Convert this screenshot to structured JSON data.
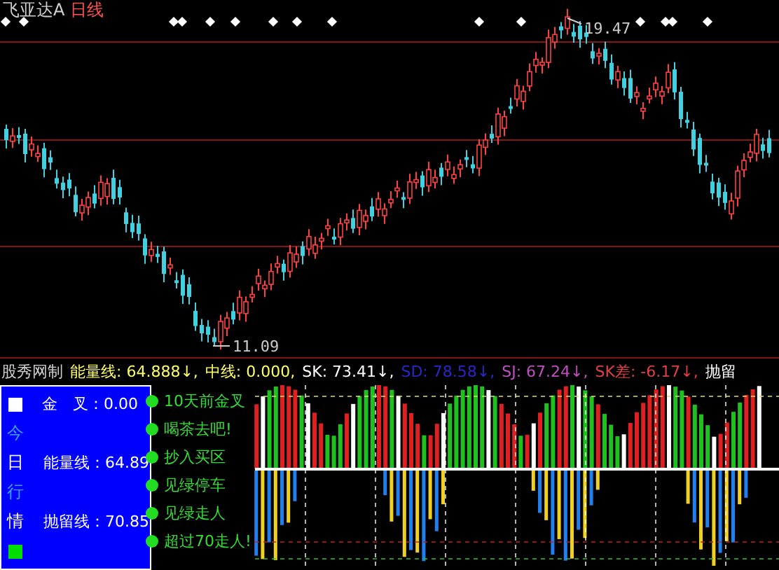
{
  "chart_title": {
    "symbol": "飞亚达A",
    "period": "日线"
  },
  "price_labels": {
    "high": "19.47",
    "low": "11.09"
  },
  "indicator_header": {
    "title": "股秀网制",
    "items": [
      {
        "label": "能量线:",
        "value": "64.888↓,",
        "color": "#ffff66"
      },
      {
        "label": "中线:",
        "value": "0.000,",
        "color": "#ffff66"
      },
      {
        "label": "SK:",
        "value": "73.41↓,",
        "color": "#ffffff"
      },
      {
        "label": "SD:",
        "value": "78.58↓,",
        "color": "#2828c8"
      },
      {
        "label": "SJ:",
        "value": "67.24↓,",
        "color": "#c050c0"
      },
      {
        "label": "SK差:",
        "value": "-6.17↓,",
        "color": "#e04040"
      },
      {
        "label": "抛留",
        "value": "",
        "color": "#ffffff"
      }
    ]
  },
  "info_panel": {
    "rows": [
      {
        "kind": "square",
        "color": "#ffffff",
        "text": "金　叉：0.00"
      },
      {
        "kind": "char",
        "char": "今",
        "color": "#3fa0ff"
      },
      {
        "kind": "char",
        "char": "日",
        "color": "#ffffff",
        "text": "能量线：64.89"
      },
      {
        "kind": "char",
        "char": "行",
        "color": "#3fa0ff"
      },
      {
        "kind": "char",
        "char": "情",
        "color": "#ffffff",
        "text": "抛留线：70.85"
      },
      {
        "kind": "square",
        "color": "#00dd00"
      }
    ]
  },
  "signals": [
    "10天前金叉",
    "喝茶去吧!",
    "抄入买区",
    "见绿停车",
    "见绿走人",
    "超过70走人!"
  ]
}
